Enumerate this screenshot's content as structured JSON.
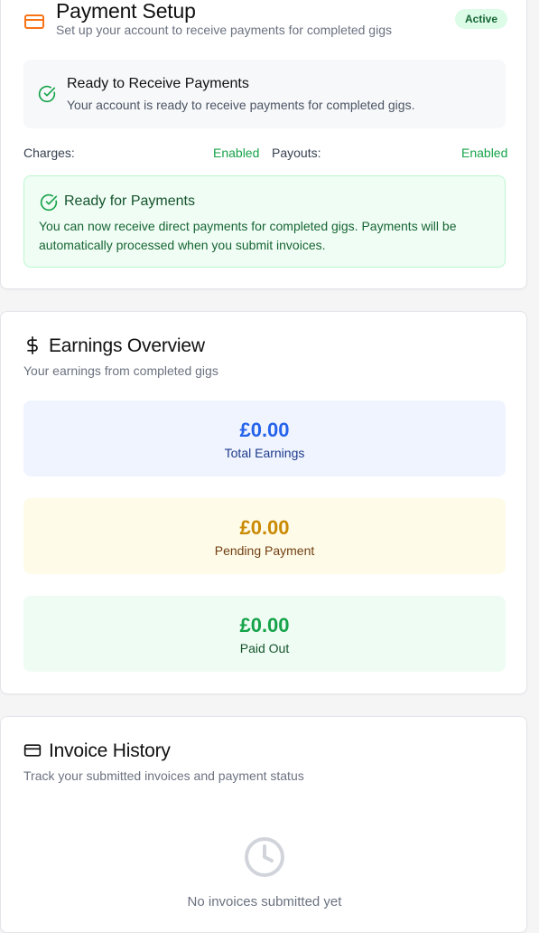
{
  "payment_setup": {
    "title": "Payment Setup",
    "subtitle": "Set up your account to receive payments for completed gigs",
    "badge": "Active",
    "ready": {
      "title": "Ready to Receive Payments",
      "subtitle": "Your account is ready to receive payments for completed gigs."
    },
    "charges_label": "Charges:",
    "charges_value": "Enabled",
    "payouts_label": "Payouts:",
    "payouts_value": "Enabled",
    "notice": {
      "title": "Ready for Payments",
      "line1": "You can now receive direct payments for completed gigs. Payments will be",
      "line2": "automatically processed when you submit invoices."
    }
  },
  "earnings": {
    "title": "Earnings Overview",
    "subtitle": "Your earnings from completed gigs",
    "cards": [
      {
        "amount": "£0.00",
        "label": "Total Earnings"
      },
      {
        "amount": "£0.00",
        "label": "Pending Payment"
      },
      {
        "amount": "£0.00",
        "label": "Paid Out"
      }
    ]
  },
  "invoice_history": {
    "title": "Invoice History",
    "subtitle": "Track your submitted invoices and payment status",
    "empty_text": "No invoices submitted yet"
  },
  "colors": {
    "accent_orange": "#f97316",
    "success_green": "#16a34a",
    "total_blue": "#2563eb",
    "pending_amber": "#ca8a04"
  },
  "icons": {
    "payment_setup": "credit-card-icon",
    "ready": "check-circle-icon",
    "earnings": "dollar-sign-icon",
    "invoice": "credit-card-icon",
    "empty": "clock-icon"
  }
}
